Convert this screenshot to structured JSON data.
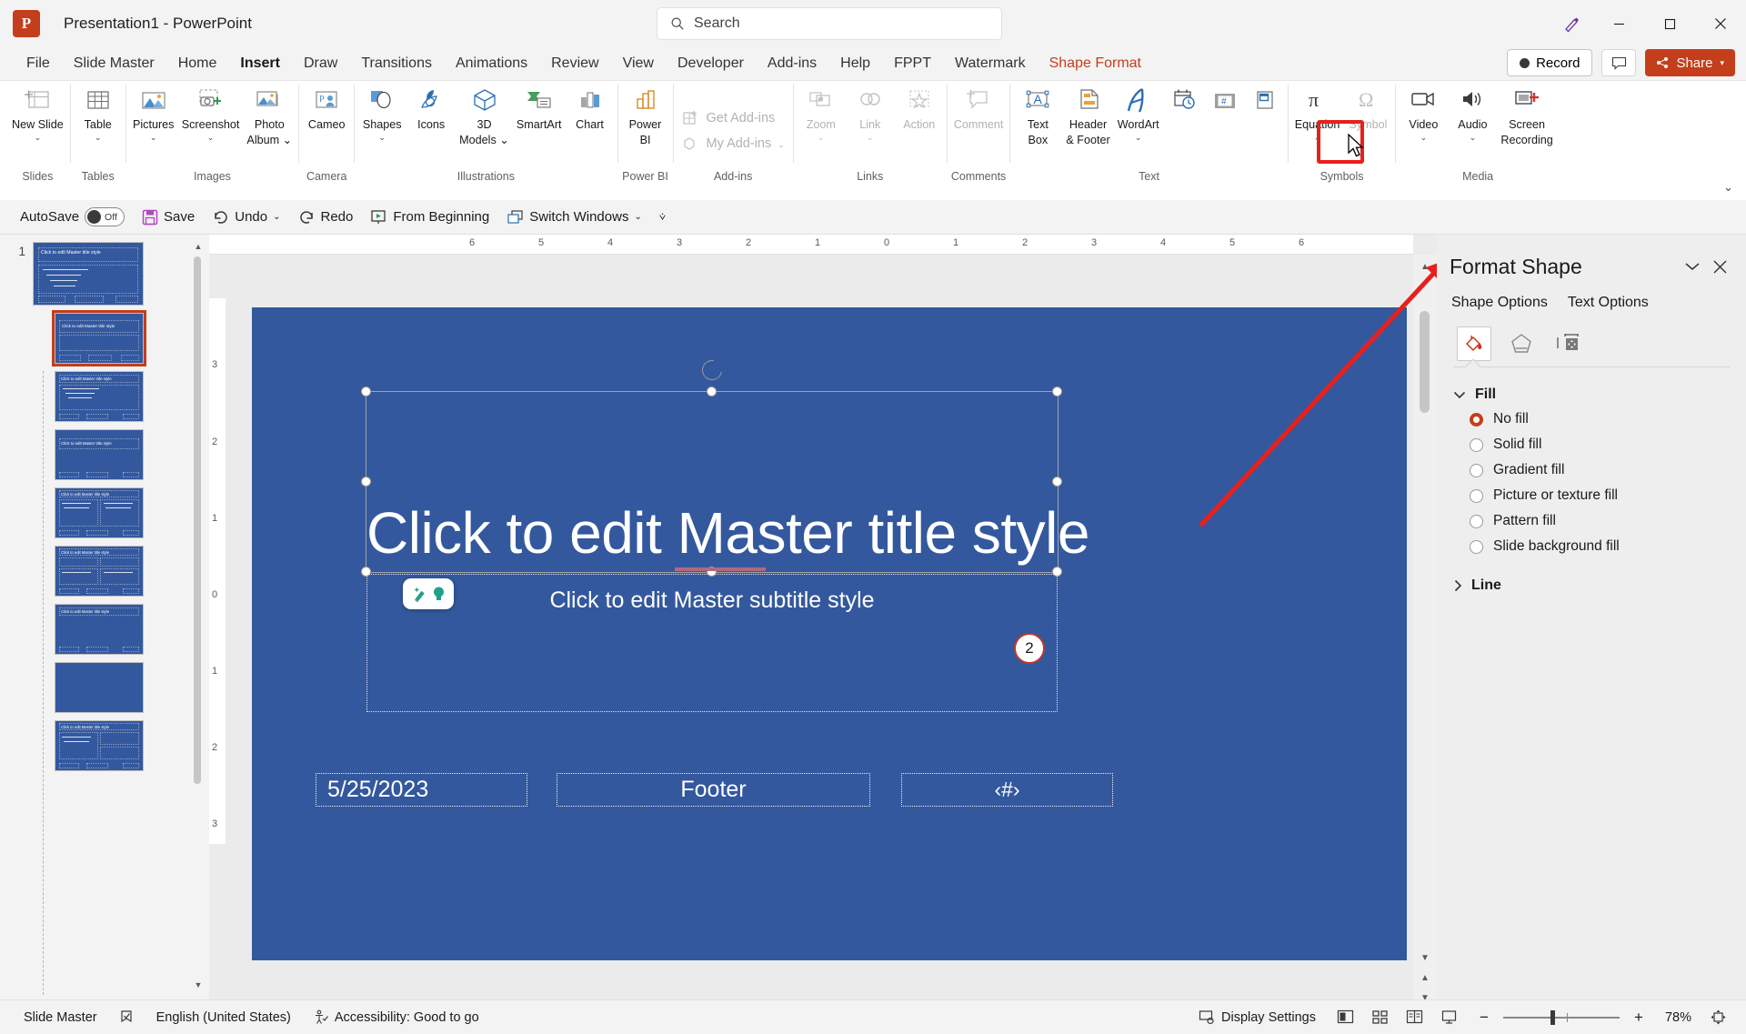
{
  "window": {
    "app_icon": "powerpoint-logo",
    "title": "Presentation1  -  PowerPoint",
    "search_placeholder": "Search",
    "minimize": "–",
    "maximize": "□",
    "close": "✕"
  },
  "ribbon_tabs": {
    "items": [
      {
        "label": "File",
        "active": false
      },
      {
        "label": "Slide Master",
        "active": false
      },
      {
        "label": "Home",
        "active": false
      },
      {
        "label": "Insert",
        "active": true
      },
      {
        "label": "Draw",
        "active": false
      },
      {
        "label": "Transitions",
        "active": false
      },
      {
        "label": "Animations",
        "active": false
      },
      {
        "label": "Review",
        "active": false
      },
      {
        "label": "View",
        "active": false
      },
      {
        "label": "Developer",
        "active": false
      },
      {
        "label": "Add-ins",
        "active": false
      },
      {
        "label": "Help",
        "active": false
      },
      {
        "label": "FPPT",
        "active": false
      },
      {
        "label": "Watermark",
        "active": false
      },
      {
        "label": "Shape Format",
        "active": false
      }
    ],
    "record_label": "Record",
    "share_label": "Share",
    "accent_color": "#c43e1c"
  },
  "ribbon": {
    "groups": [
      {
        "name": "Slides",
        "items": [
          {
            "label": "New Slide",
            "icon": "new-slide-icon",
            "dropdown": true
          }
        ]
      },
      {
        "name": "Tables",
        "items": [
          {
            "label": "Table",
            "icon": "table-icon",
            "dropdown": true
          }
        ]
      },
      {
        "name": "Images",
        "items": [
          {
            "label": "Pictures",
            "icon": "pictures-icon",
            "dropdown": true
          },
          {
            "label": "Screenshot",
            "icon": "screenshot-icon",
            "dropdown": true
          },
          {
            "label": "Photo Album",
            "icon": "photo-album-icon",
            "dropdown": true
          }
        ]
      },
      {
        "name": "Camera",
        "items": [
          {
            "label": "Cameo",
            "icon": "cameo-icon",
            "dropdown": false
          }
        ]
      },
      {
        "name": "Illustrations",
        "items": [
          {
            "label": "Shapes",
            "icon": "shapes-icon",
            "dropdown": true
          },
          {
            "label": "Icons",
            "icon": "icons-icon",
            "dropdown": false
          },
          {
            "label": "3D Models",
            "icon": "3d-models-icon",
            "dropdown": true
          },
          {
            "label": "SmartArt",
            "icon": "smartart-icon",
            "dropdown": false
          },
          {
            "label": "Chart",
            "icon": "chart-icon",
            "dropdown": false
          }
        ]
      },
      {
        "name": "Power BI",
        "items": [
          {
            "label": "Power BI",
            "icon": "power-bi-icon",
            "dropdown": false
          }
        ]
      },
      {
        "name": "Add-ins",
        "items": [
          {
            "label": "Get Add-ins",
            "icon": "get-addins-icon",
            "disabled": true
          },
          {
            "label": "My Add-ins",
            "icon": "my-addins-icon",
            "disabled": true,
            "dropdown": true
          }
        ]
      },
      {
        "name": "Links",
        "items": [
          {
            "label": "Zoom",
            "icon": "zoom-icon",
            "disabled": true,
            "dropdown": true
          },
          {
            "label": "Link",
            "icon": "link-icon",
            "disabled": true,
            "dropdown": true
          },
          {
            "label": "Action",
            "icon": "action-icon",
            "disabled": true
          }
        ]
      },
      {
        "name": "Comments",
        "items": [
          {
            "label": "Comment",
            "icon": "comment-icon",
            "disabled": true
          }
        ]
      },
      {
        "name": "Text",
        "items": [
          {
            "label": "Text Box",
            "icon": "text-box-icon"
          },
          {
            "label": "Header & Footer",
            "icon": "header-footer-icon"
          },
          {
            "label": "WordArt",
            "icon": "wordart-icon",
            "dropdown": true
          },
          {
            "label": "Date & Time",
            "icon": "date-time-icon"
          },
          {
            "label": "Slide Number",
            "icon": "slide-number-icon",
            "highlighted": true
          },
          {
            "label": "Object",
            "icon": "object-icon"
          }
        ]
      },
      {
        "name": "Symbols",
        "items": [
          {
            "label": "Equation",
            "icon": "equation-icon",
            "dropdown": true
          },
          {
            "label": "Symbol",
            "icon": "symbol-icon",
            "disabled": true
          }
        ]
      },
      {
        "name": "Media",
        "items": [
          {
            "label": "Video",
            "icon": "video-icon",
            "dropdown": true
          },
          {
            "label": "Audio",
            "icon": "audio-icon",
            "dropdown": true
          },
          {
            "label": "Screen Recording",
            "icon": "screen-recording-icon"
          }
        ]
      }
    ]
  },
  "quick_access": {
    "autosave_label": "AutoSave",
    "autosave_state": "Off",
    "save_label": "Save",
    "undo_label": "Undo",
    "redo_label": "Redo",
    "from_beginning_label": "From Beginning",
    "switch_windows_label": "Switch Windows"
  },
  "thumbnails": {
    "slide_number": "1",
    "master_title": "Click to edit Master title style",
    "layout_title": "Click to edit Master title style"
  },
  "slide": {
    "background_color": "#33589e",
    "title": "Click to edit Master title style",
    "subtitle": "Click to edit Master subtitle style",
    "footer_date": "5/25/2023",
    "footer_text": "Footer",
    "footer_slide_number": "‹#›",
    "slide_number_badge": "2"
  },
  "ruler": {
    "horizontal_ticks": [
      "6",
      "5",
      "4",
      "3",
      "2",
      "1",
      "0",
      "1",
      "2",
      "3",
      "4",
      "5",
      "6"
    ],
    "vertical_ticks": [
      "3",
      "2",
      "1",
      "0",
      "1",
      "2",
      "3"
    ]
  },
  "format_pane": {
    "title": "Format Shape",
    "collapse_icon": "chevron-down-icon",
    "close_icon": "close-icon",
    "tabs": [
      {
        "label": "Shape Options",
        "active": true
      },
      {
        "label": "Text Options",
        "active": false
      }
    ],
    "icon_tabs": [
      {
        "name": "fill-and-line-icon",
        "selected": true
      },
      {
        "name": "effects-icon",
        "selected": false
      },
      {
        "name": "size-and-properties-icon",
        "selected": false
      }
    ],
    "sections": [
      {
        "label": "Fill",
        "expanded": true,
        "options": [
          {
            "label": "No fill",
            "accel": "N",
            "selected": true
          },
          {
            "label": "Solid fill",
            "accel": "S",
            "selected": false
          },
          {
            "label": "Gradient fill",
            "accel": "G",
            "selected": false
          },
          {
            "label": "Picture or texture fill",
            "accel": "P",
            "selected": false
          },
          {
            "label": "Pattern fill",
            "accel": "a",
            "selected": false
          },
          {
            "label": "Slide background fill",
            "accel": "b",
            "selected": false
          }
        ]
      },
      {
        "label": "Line",
        "expanded": false,
        "options": []
      }
    ]
  },
  "status_bar": {
    "view_name": "Slide Master",
    "language": "English (United States)",
    "accessibility": "Accessibility: Good to go",
    "display_settings": "Display Settings",
    "zoom_level": "78%",
    "zoom_out": "−",
    "zoom_in": "+"
  }
}
